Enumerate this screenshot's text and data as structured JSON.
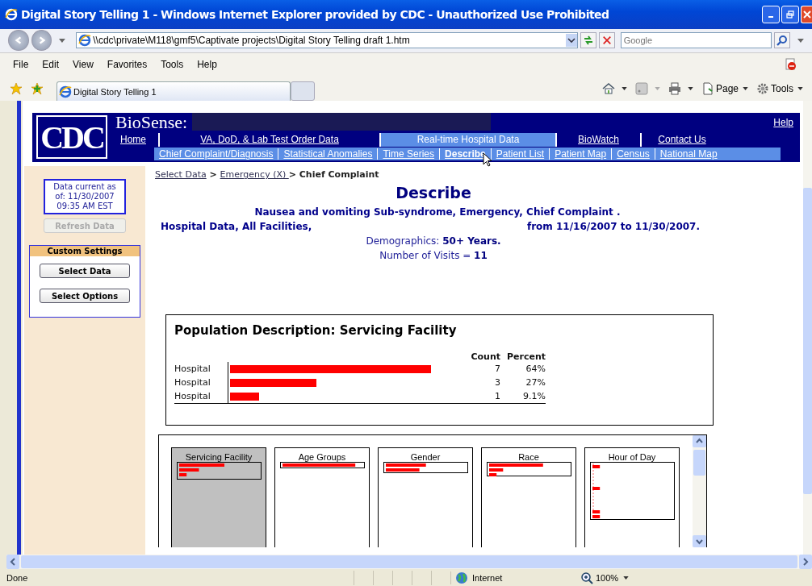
{
  "window": {
    "title": "Digital Story Telling 1 - Windows Internet Explorer provided by CDC - Unauthorized Use Prohibited"
  },
  "address_bar": {
    "value": "\\\\cdc\\private\\M118\\gmf5\\Captivate projects\\Digital Story Telling draft 1.htm"
  },
  "search": {
    "placeholder": "Google"
  },
  "menu": [
    "File",
    "Edit",
    "View",
    "Favorites",
    "Tools",
    "Help"
  ],
  "tabs": [
    {
      "label": "Digital Story Telling 1",
      "selected": true
    }
  ],
  "command_bar": [
    "Page",
    "Tools"
  ],
  "page": {
    "logo": "CDC",
    "app_name": "BioSense:",
    "help": "Help",
    "nav": [
      {
        "label": "Home",
        "selected": false
      },
      {
        "label": "VA, DoD, & Lab Test Order Data",
        "selected": false
      },
      {
        "label": "Real-time Hospital Data",
        "selected": true
      },
      {
        "label": "BioWatch",
        "selected": false
      },
      {
        "label": "Contact Us",
        "selected": false
      }
    ],
    "subnav": [
      {
        "label": "Chief Complaint/Diagnosis",
        "selected": false
      },
      {
        "label": "Statistical Anomalies",
        "selected": false
      },
      {
        "label": "Time Series",
        "selected": false
      },
      {
        "label": "Describe",
        "selected": true
      },
      {
        "label": "Patient List",
        "selected": false
      },
      {
        "label": "Patient Map",
        "selected": false
      },
      {
        "label": "Census",
        "selected": false
      },
      {
        "label": "National Map",
        "selected": false
      }
    ],
    "sidebar": {
      "data_current": [
        "Data current as",
        "of:  11/30/2007",
        "09:35 AM EST"
      ],
      "refresh": {
        "label": "Refresh Data",
        "disabled": true
      },
      "custom_settings": {
        "title": "Custom Settings",
        "buttons": [
          "Select Data",
          "Select Options"
        ]
      }
    },
    "breadcrumb": [
      {
        "text": "Select Data",
        "kind": "link"
      },
      {
        "text": " > ",
        "kind": "text"
      },
      {
        "text": "Emergency (X) ",
        "kind": "link"
      },
      {
        "text": "> Chief Complaint",
        "kind": "text"
      }
    ],
    "heading": "Describe",
    "summary": {
      "line_1": "Nausea and vomiting Sub-syndrome,  Emergency, Chief Complaint .",
      "line_2_left": "Hospital Data, All Facilities,",
      "line_2_right": "from 11/16/2007 to 11/30/2007."
    },
    "demographics": "Demographics: **50+ Years.**",
    "visits": "Number of Visits = **11**",
    "population": {
      "title": "Population Description: Servicing Facility",
      "columns": [
        "Count",
        "Percent"
      ],
      "rows": [
        {
          "label": "Hospital",
          "count": "7",
          "percent": "64%",
          "level": 0.84
        },
        {
          "label": "Hospital",
          "count": "3",
          "percent": "27%",
          "level": 0.36
        },
        {
          "label": "Hospital",
          "count": "1",
          "percent": "9.1%",
          "level": 0.12
        }
      ]
    },
    "thumbnails": [
      {
        "label": "Servicing Facility",
        "selected": true
      },
      {
        "label": "Age Groups",
        "selected": false
      },
      {
        "label": "Gender",
        "selected": false
      },
      {
        "label": "Race",
        "selected": false
      },
      {
        "label": "Hour of Day",
        "selected": false
      }
    ]
  },
  "status_bar": {
    "text": "Done",
    "zone": "Internet",
    "zoom": "100%"
  }
}
